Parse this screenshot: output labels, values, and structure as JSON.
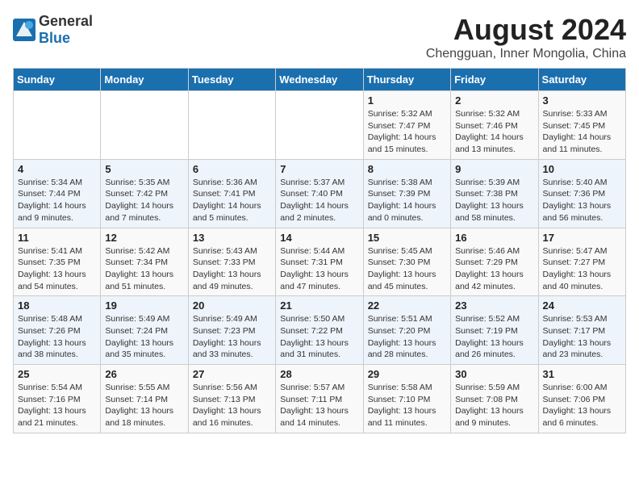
{
  "app": {
    "name_general": "General",
    "name_blue": "Blue"
  },
  "header": {
    "month_year": "August 2024",
    "location": "Chengguan, Inner Mongolia, China"
  },
  "weekdays": [
    "Sunday",
    "Monday",
    "Tuesday",
    "Wednesday",
    "Thursday",
    "Friday",
    "Saturday"
  ],
  "weeks": [
    [
      {
        "day": "",
        "info": ""
      },
      {
        "day": "",
        "info": ""
      },
      {
        "day": "",
        "info": ""
      },
      {
        "day": "",
        "info": ""
      },
      {
        "day": "1",
        "info": "Sunrise: 5:32 AM\nSunset: 7:47 PM\nDaylight: 14 hours and 15 minutes."
      },
      {
        "day": "2",
        "info": "Sunrise: 5:32 AM\nSunset: 7:46 PM\nDaylight: 14 hours and 13 minutes."
      },
      {
        "day": "3",
        "info": "Sunrise: 5:33 AM\nSunset: 7:45 PM\nDaylight: 14 hours and 11 minutes."
      }
    ],
    [
      {
        "day": "4",
        "info": "Sunrise: 5:34 AM\nSunset: 7:44 PM\nDaylight: 14 hours and 9 minutes."
      },
      {
        "day": "5",
        "info": "Sunrise: 5:35 AM\nSunset: 7:42 PM\nDaylight: 14 hours and 7 minutes."
      },
      {
        "day": "6",
        "info": "Sunrise: 5:36 AM\nSunset: 7:41 PM\nDaylight: 14 hours and 5 minutes."
      },
      {
        "day": "7",
        "info": "Sunrise: 5:37 AM\nSunset: 7:40 PM\nDaylight: 14 hours and 2 minutes."
      },
      {
        "day": "8",
        "info": "Sunrise: 5:38 AM\nSunset: 7:39 PM\nDaylight: 14 hours and 0 minutes."
      },
      {
        "day": "9",
        "info": "Sunrise: 5:39 AM\nSunset: 7:38 PM\nDaylight: 13 hours and 58 minutes."
      },
      {
        "day": "10",
        "info": "Sunrise: 5:40 AM\nSunset: 7:36 PM\nDaylight: 13 hours and 56 minutes."
      }
    ],
    [
      {
        "day": "11",
        "info": "Sunrise: 5:41 AM\nSunset: 7:35 PM\nDaylight: 13 hours and 54 minutes."
      },
      {
        "day": "12",
        "info": "Sunrise: 5:42 AM\nSunset: 7:34 PM\nDaylight: 13 hours and 51 minutes."
      },
      {
        "day": "13",
        "info": "Sunrise: 5:43 AM\nSunset: 7:33 PM\nDaylight: 13 hours and 49 minutes."
      },
      {
        "day": "14",
        "info": "Sunrise: 5:44 AM\nSunset: 7:31 PM\nDaylight: 13 hours and 47 minutes."
      },
      {
        "day": "15",
        "info": "Sunrise: 5:45 AM\nSunset: 7:30 PM\nDaylight: 13 hours and 45 minutes."
      },
      {
        "day": "16",
        "info": "Sunrise: 5:46 AM\nSunset: 7:29 PM\nDaylight: 13 hours and 42 minutes."
      },
      {
        "day": "17",
        "info": "Sunrise: 5:47 AM\nSunset: 7:27 PM\nDaylight: 13 hours and 40 minutes."
      }
    ],
    [
      {
        "day": "18",
        "info": "Sunrise: 5:48 AM\nSunset: 7:26 PM\nDaylight: 13 hours and 38 minutes."
      },
      {
        "day": "19",
        "info": "Sunrise: 5:49 AM\nSunset: 7:24 PM\nDaylight: 13 hours and 35 minutes."
      },
      {
        "day": "20",
        "info": "Sunrise: 5:49 AM\nSunset: 7:23 PM\nDaylight: 13 hours and 33 minutes."
      },
      {
        "day": "21",
        "info": "Sunrise: 5:50 AM\nSunset: 7:22 PM\nDaylight: 13 hours and 31 minutes."
      },
      {
        "day": "22",
        "info": "Sunrise: 5:51 AM\nSunset: 7:20 PM\nDaylight: 13 hours and 28 minutes."
      },
      {
        "day": "23",
        "info": "Sunrise: 5:52 AM\nSunset: 7:19 PM\nDaylight: 13 hours and 26 minutes."
      },
      {
        "day": "24",
        "info": "Sunrise: 5:53 AM\nSunset: 7:17 PM\nDaylight: 13 hours and 23 minutes."
      }
    ],
    [
      {
        "day": "25",
        "info": "Sunrise: 5:54 AM\nSunset: 7:16 PM\nDaylight: 13 hours and 21 minutes."
      },
      {
        "day": "26",
        "info": "Sunrise: 5:55 AM\nSunset: 7:14 PM\nDaylight: 13 hours and 18 minutes."
      },
      {
        "day": "27",
        "info": "Sunrise: 5:56 AM\nSunset: 7:13 PM\nDaylight: 13 hours and 16 minutes."
      },
      {
        "day": "28",
        "info": "Sunrise: 5:57 AM\nSunset: 7:11 PM\nDaylight: 13 hours and 14 minutes."
      },
      {
        "day": "29",
        "info": "Sunrise: 5:58 AM\nSunset: 7:10 PM\nDaylight: 13 hours and 11 minutes."
      },
      {
        "day": "30",
        "info": "Sunrise: 5:59 AM\nSunset: 7:08 PM\nDaylight: 13 hours and 9 minutes."
      },
      {
        "day": "31",
        "info": "Sunrise: 6:00 AM\nSunset: 7:06 PM\nDaylight: 13 hours and 6 minutes."
      }
    ]
  ]
}
